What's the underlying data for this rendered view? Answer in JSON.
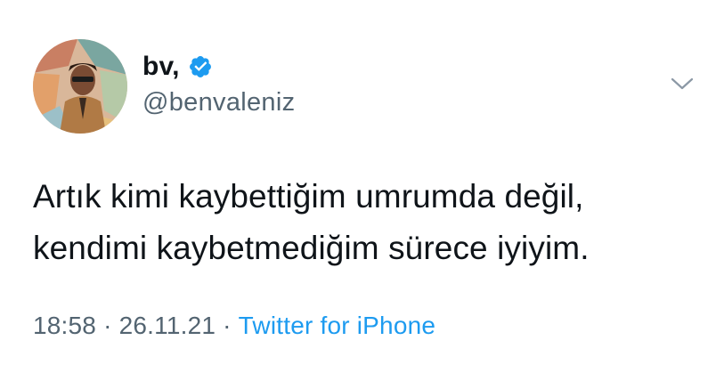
{
  "author": {
    "display_name": "bv,",
    "handle": "@benvaleniz",
    "verified": true,
    "verified_color": "#1d9bf0"
  },
  "tweet": {
    "lines": [
      "Artık kimi kaybettiğim umrumda değil,",
      "kendimi kaybetmediğim sürece iyiyim."
    ]
  },
  "meta": {
    "time": "18:58",
    "separator": "·",
    "date": "26.11.21",
    "source": "Twitter for iPhone",
    "source_color": "#1d9bf0"
  },
  "icons": {
    "menu": "chevron-down-icon",
    "badge": "verified-badge-icon"
  }
}
